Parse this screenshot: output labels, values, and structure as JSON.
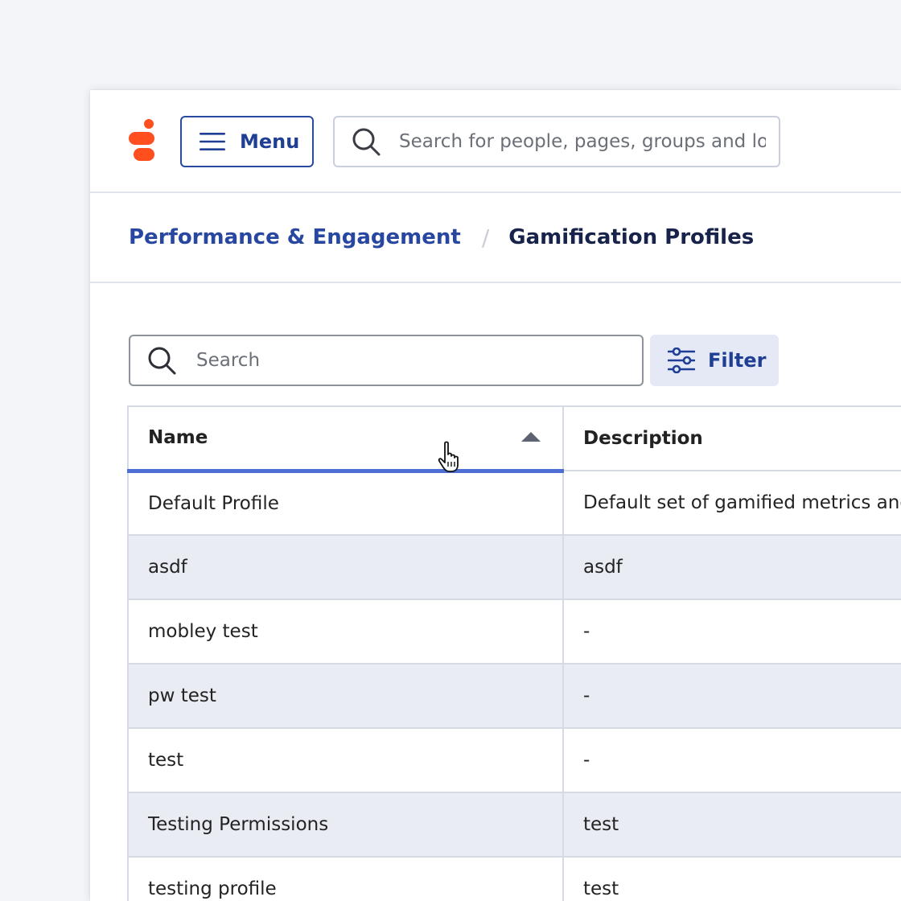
{
  "header": {
    "menu_label": "Menu",
    "search_placeholder": "Search for people, pages, groups and loc..."
  },
  "breadcrumb": {
    "parent": "Performance & Engagement",
    "separator": "/",
    "current": "Gamification Profiles"
  },
  "toolbar": {
    "search_placeholder": "Search",
    "filter_label": "Filter"
  },
  "table": {
    "columns": [
      {
        "label": "Name",
        "sorted": "ascending"
      },
      {
        "label": "Description"
      }
    ],
    "rows": [
      {
        "name": "Default Profile",
        "description": "Default set of gamified metrics and m"
      },
      {
        "name": "asdf",
        "description": "asdf"
      },
      {
        "name": "mobley test",
        "description": "-"
      },
      {
        "name": "pw test",
        "description": "-"
      },
      {
        "name": "test",
        "description": "-"
      },
      {
        "name": "Testing Permissions",
        "description": "test"
      },
      {
        "name": "testing profile",
        "description": "test"
      }
    ]
  },
  "colors": {
    "brand_orange": "#ff4f1f",
    "primary_blue": "#1f3f94",
    "sort_indicator": "#4d6fd3",
    "alt_row": "#e9ecf3"
  },
  "icons": {
    "logo": "genesys-logo",
    "menu": "hamburger-icon",
    "search": "search-icon",
    "filter": "sliders-icon",
    "sort": "sort-ascending-icon",
    "cursor": "hand-pointer-icon"
  }
}
